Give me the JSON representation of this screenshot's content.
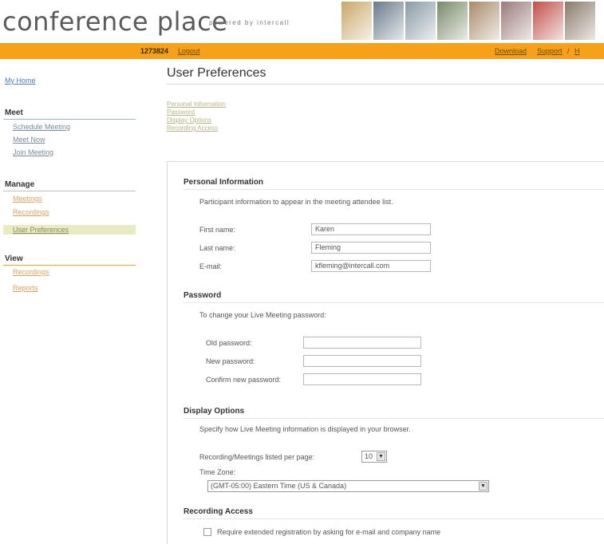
{
  "header": {
    "logo_text": "conference place",
    "tagline": "powered by intercall",
    "photos": [
      "#c9a86a",
      "#6a7a8a",
      "#8a9aa6",
      "#7a8a6a",
      "#a88a6a",
      "#9a7a7a",
      "#c0504a",
      "#8a7a6a"
    ]
  },
  "topbar": {
    "user_id": "1273824",
    "logout": "Logout",
    "download": "Download",
    "support": "Support",
    "separator": "/",
    "more": "H"
  },
  "sidebar": {
    "home": "My Home",
    "meet": {
      "heading": "Meet",
      "items": [
        "Schedule Meeting",
        "Meet Now",
        "Join Meeting"
      ]
    },
    "manage": {
      "heading": "Manage",
      "items": [
        "Meetings",
        "Recordings",
        "User Preferences"
      ]
    },
    "view": {
      "heading": "View",
      "items": [
        "Recordings",
        "Reports"
      ]
    },
    "colors": {
      "meet_rule": "#9ab3d6",
      "manage_rule": "#c0c0c0",
      "view_rule": "#f7a11a"
    }
  },
  "main": {
    "title": "User Preferences",
    "anchors": [
      "Personal Information",
      "Password",
      "Display Options",
      "Recording Access"
    ],
    "personal": {
      "title": "Personal Information",
      "description": "Participant information to appear in the meeting attendee list.",
      "first_name_label": "First name:",
      "first_name_value": "Karen",
      "last_name_label": "Last name:",
      "last_name_value": "Fleming",
      "email_label": "E-mail:",
      "email_value": "kfleming@intercall.com"
    },
    "password": {
      "title": "Password",
      "description": "To change your Live Meeting password:",
      "old_label": "Old password:",
      "new_label": "New password:",
      "confirm_label": "Confirm new password:"
    },
    "display": {
      "title": "Display Options",
      "description": "Specify how Live Meeting information is displayed in your browser.",
      "per_page_label": "Recording/Meetings listed per page:",
      "per_page_value": "10",
      "timezone_label": "Time Zone:",
      "timezone_value": "(GMT-05:00) Eastern Time (US & Canada)"
    },
    "recording": {
      "title": "Recording Access",
      "checkbox_label": "Require extended registration by asking for e-mail and company name"
    }
  }
}
